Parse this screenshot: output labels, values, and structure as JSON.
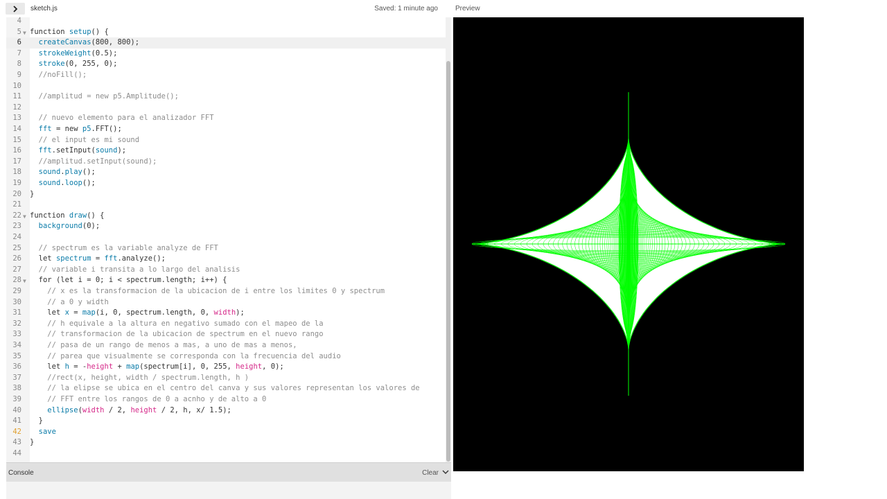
{
  "editor": {
    "file_name": "sketch.js",
    "saved_status": "Saved: 1 minute ago",
    "lines": [
      {
        "n": "4",
        "html": ""
      },
      {
        "n": "5",
        "fold": true,
        "html": "<span class='k'>function</span> <span class='f'>setup</span>() {"
      },
      {
        "n": "6",
        "active": true,
        "html": "  <span class='f'>createCanvas</span>(800, 800);"
      },
      {
        "n": "7",
        "html": "  <span class='f'>strokeWeight</span>(0.5);"
      },
      {
        "n": "8",
        "html": "  <span class='f'>stroke</span>(0, 255, 0);"
      },
      {
        "n": "9",
        "html": "  <span class='c'>//noFill();</span>"
      },
      {
        "n": "10",
        "html": ""
      },
      {
        "n": "11",
        "html": "  <span class='c'>//amplitud = new p5.Amplitude();</span>"
      },
      {
        "n": "12",
        "html": ""
      },
      {
        "n": "13",
        "html": "  <span class='c'>// nuevo elemento para el analizador FFT</span>"
      },
      {
        "n": "14",
        "html": "  <span class='f'>fft</span> = new <span class='f'>p5</span>.FFT();"
      },
      {
        "n": "15",
        "html": "  <span class='c'>// el input es mi sound</span>"
      },
      {
        "n": "16",
        "html": "  <span class='f'>fft</span>.setInput(<span class='f'>sound</span>);"
      },
      {
        "n": "17",
        "html": "  <span class='c'>//amplitud.setInput(sound);</span>"
      },
      {
        "n": "18",
        "html": "  <span class='f'>sound</span>.<span class='f'>play</span>();"
      },
      {
        "n": "19",
        "html": "  <span class='f'>sound</span>.<span class='f'>loop</span>();"
      },
      {
        "n": "20",
        "html": "}"
      },
      {
        "n": "21",
        "html": ""
      },
      {
        "n": "22",
        "fold": true,
        "html": "<span class='k'>function</span> <span class='f'>draw</span>() {"
      },
      {
        "n": "23",
        "html": "  <span class='f'>background</span>(0);"
      },
      {
        "n": "24",
        "html": ""
      },
      {
        "n": "25",
        "html": "  <span class='c'>// spectrum es la variable analyze de FFT</span>"
      },
      {
        "n": "26",
        "html": "  <span class='k'>let</span> <span class='f'>spectrum</span> = <span class='f'>fft</span>.analyze();"
      },
      {
        "n": "27",
        "html": "  <span class='c'>// variable i transita a lo largo del analisis</span>"
      },
      {
        "n": "28",
        "fold": true,
        "html": "  <span class='k'>for</span> (<span class='k'>let</span> i = 0; i &lt; spectrum.length; i++) {"
      },
      {
        "n": "29",
        "html": "    <span class='c'>// x es la transformacion de la ubicacion de i entre los limites 0 y spectrum</span>"
      },
      {
        "n": "30",
        "html": "    <span class='c'>// a 0 y width</span>"
      },
      {
        "n": "31",
        "html": "    <span class='k'>let</span> <span class='f'>x</span> = <span class='f'>map</span>(i, 0, spectrum.length, 0, <span class='p'>width</span>);"
      },
      {
        "n": "32",
        "html": "    <span class='c'>// h equivale a la altura en negativo sumado con el mapeo de la</span>"
      },
      {
        "n": "33",
        "html": "    <span class='c'>// transformacion de la ubicacion de spectrum en el nuevo rango</span>"
      },
      {
        "n": "34",
        "html": "    <span class='c'>// pasa de un rango de menos a mas, a uno de mas a menos,</span>"
      },
      {
        "n": "35",
        "html": "    <span class='c'>// parea que visualmente se corresponda con la frecuencia del audio</span>"
      },
      {
        "n": "36",
        "html": "    <span class='k'>let</span> <span class='f'>h</span> = -<span class='p'>height</span> + <span class='f'>map</span>(spectrum[i], 0, 255, <span class='p'>height</span>, 0);"
      },
      {
        "n": "37",
        "html": "    <span class='c'>//rect(x, height, width / spectrum.length, h )</span>"
      },
      {
        "n": "38",
        "html": "    <span class='c'>// la elipse se ubica en el centro del canva y sus valores representan los valores de</span>"
      },
      {
        "n": "39",
        "html": "    <span class='c'>// FFT entre los rangos de 0 a acnho y de alto a 0</span>"
      },
      {
        "n": "40",
        "html": "    <span class='f'>ellipse</span>(<span class='p'>width</span> / 2, <span class='p'>height</span> / 2, h, x/ 1.5);"
      },
      {
        "n": "41",
        "html": "  }"
      },
      {
        "n": "42",
        "bookmark": true,
        "html": "  <span class='f'>save</span>"
      },
      {
        "n": "43",
        "html": "}"
      },
      {
        "n": "44",
        "html": ""
      }
    ]
  },
  "preview": {
    "label": "Preview",
    "canvas_background": "#000000",
    "stroke_color": "#00ff00"
  },
  "console": {
    "label": "Console",
    "clear_label": "Clear"
  },
  "colors": {
    "keyword": "#333333",
    "function": "#0b7ca9",
    "comment": "#8d8d8d",
    "builtin": "#d52889"
  }
}
